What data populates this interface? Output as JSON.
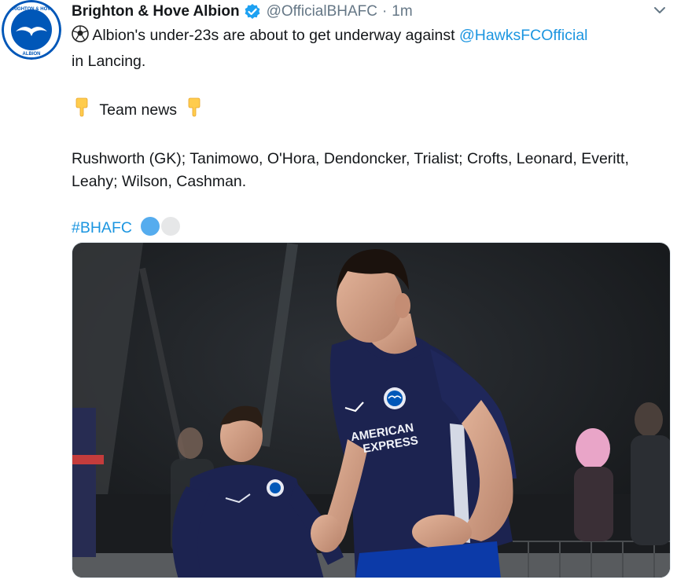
{
  "tweet": {
    "author_name": "Brighton & Hove Albion",
    "handle": "@OfficialBHAFC",
    "separator": "·",
    "time": "1m",
    "line1_text": " Albion's under-23s are about to get underway against ",
    "mention": "@HawksFCOfficial",
    "line2_text": "in Lancing.",
    "team_news_label": "Team news",
    "lineup": "Rushworth (GK); Tanimowo, O'Hora, Dendoncker, Trialist; Crofts, Leonard, Everitt, Leahy; Wilson, Cashman.",
    "hashtag": "#BHAFC"
  },
  "avatar": {
    "text_top": "BRIGHTON & HOVE",
    "text_bottom": "ALBION"
  },
  "shirt": {
    "sponsor_line1": "AMERICAN",
    "sponsor_line2": "EXPRESS"
  },
  "colors": {
    "brand_blue": "#0057b8",
    "link_blue": "#1b95e0",
    "muted": "#657786",
    "verified": "#1da1f2",
    "kit_navy": "#1c2350"
  },
  "icons": {
    "verified": "verified-badge-icon",
    "caret": "chevron-down-icon",
    "ball": "soccer-ball-emoji",
    "pointing": "pointing-down-emoji"
  }
}
